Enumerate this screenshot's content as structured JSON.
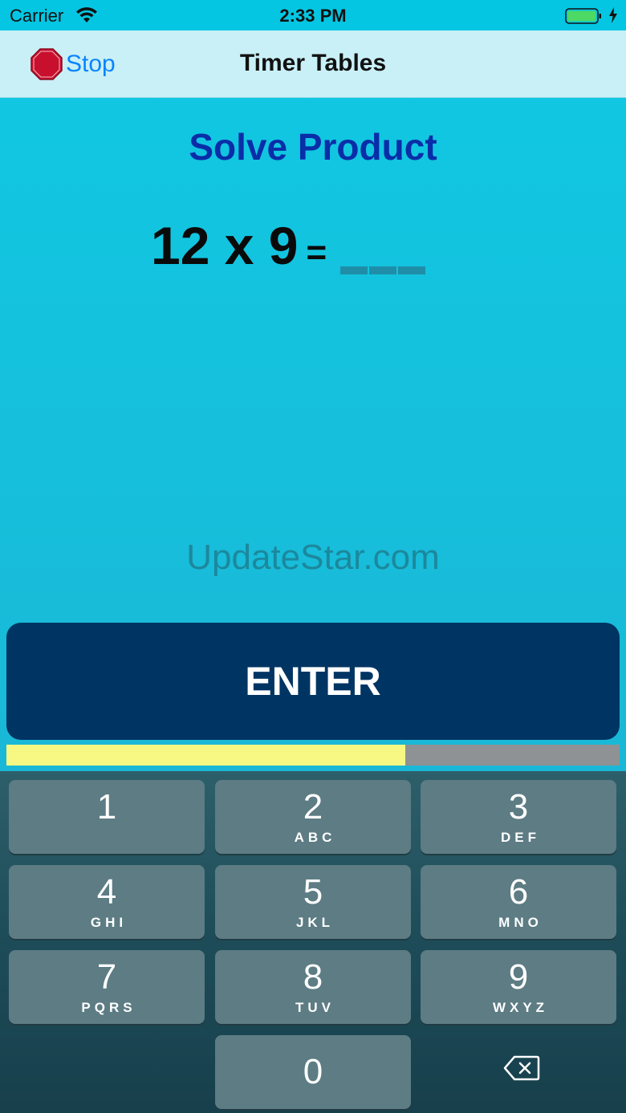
{
  "status_bar": {
    "carrier": "Carrier",
    "time": "2:33 PM",
    "wifi_icon": "wifi-icon",
    "battery_icon": "battery-icon",
    "charging_icon": "charging-bolt-icon"
  },
  "nav": {
    "stop_icon": "stop-sign-icon",
    "stop_label": "Stop",
    "title": "Timer Tables"
  },
  "content": {
    "title": "Solve Product",
    "problem": "12 x 9",
    "equals": "=",
    "answer_value": "",
    "watermark": "UpdateStar.com"
  },
  "enter": {
    "label": "ENTER"
  },
  "timer": {
    "remaining_fraction": 0.65
  },
  "keypad": {
    "keys": [
      {
        "digit": "1",
        "letters": ""
      },
      {
        "digit": "2",
        "letters": "ABC"
      },
      {
        "digit": "3",
        "letters": "DEF"
      },
      {
        "digit": "4",
        "letters": "GHI"
      },
      {
        "digit": "5",
        "letters": "JKL"
      },
      {
        "digit": "6",
        "letters": "MNO"
      },
      {
        "digit": "7",
        "letters": "PQRS"
      },
      {
        "digit": "8",
        "letters": "TUV"
      },
      {
        "digit": "9",
        "letters": "WXYZ"
      },
      {
        "digit": "0",
        "letters": ""
      }
    ],
    "delete_icon": "backspace-icon"
  },
  "colors": {
    "background": "#1bc3df",
    "nav_bar": "#c9f0f7",
    "title_blue": "#0a2da8",
    "enter_button": "#003563",
    "timer_fill": "#f7f883",
    "timer_track": "#8e9294",
    "key": "#5d7c84",
    "link_blue": "#0a84ff"
  }
}
